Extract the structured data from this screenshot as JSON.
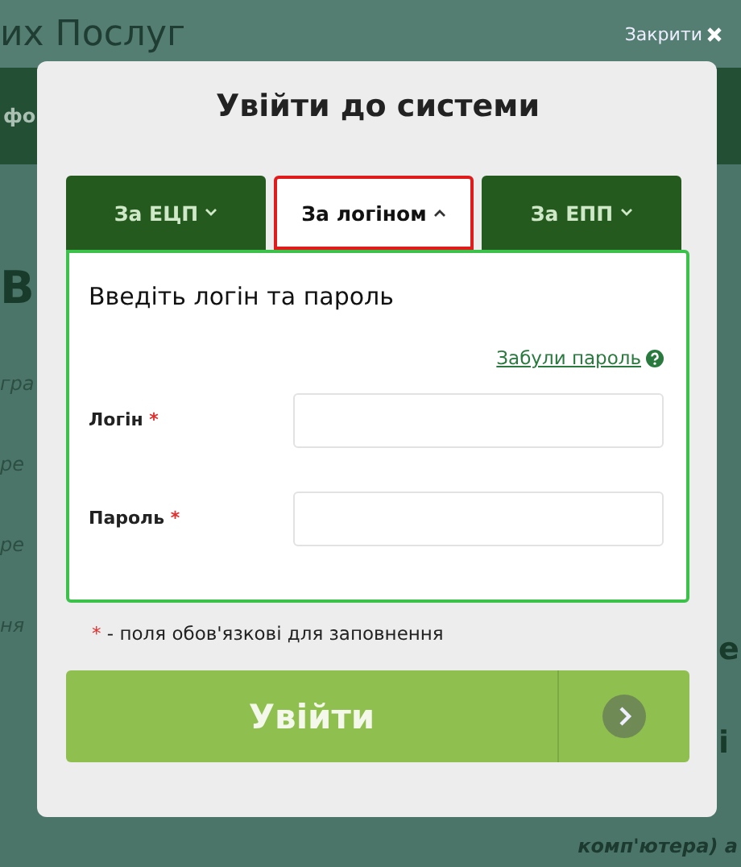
{
  "background": {
    "site_title": "их Послуг",
    "close": "Закрити",
    "nav_fragment": "фо",
    "heading_fragment": "В",
    "left_fragments": [
      "гра",
      "ре",
      "ре",
      "ня"
    ],
    "right_fragments": [
      "е",
      "і"
    ],
    "bottom_fragment": "комп'ютера)  а"
  },
  "dialog": {
    "title": "Увійти до системи",
    "tabs": [
      {
        "label": "За ЕЦП",
        "selected": false
      },
      {
        "label": "За логіном",
        "selected": true
      },
      {
        "label": "За ЕПП",
        "selected": false
      }
    ],
    "panel_heading": "Введіть логін та пароль",
    "forgot_link": "Забули пароль",
    "fields": [
      {
        "label": "Логін",
        "required_mark": "*"
      },
      {
        "label": "Пароль",
        "required_mark": "*"
      }
    ],
    "required_note_mark": "*",
    "required_note": "- поля обов'язкові для заповнення",
    "submit": "Увійти"
  }
}
